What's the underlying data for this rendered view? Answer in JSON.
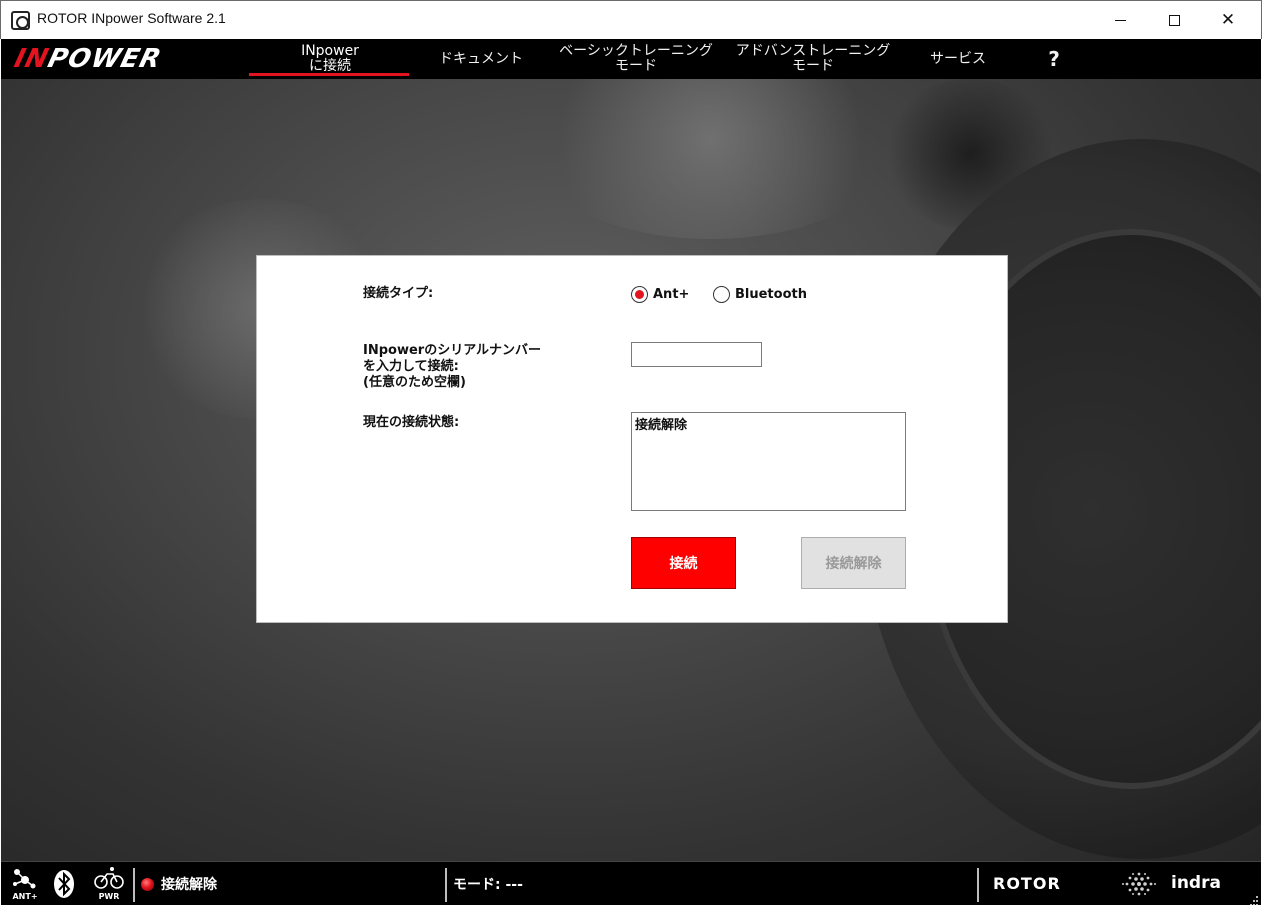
{
  "window": {
    "title": "ROTOR INpower Software 2.1"
  },
  "nav": {
    "logo_part1": "IN",
    "logo_part2": "POWER",
    "items": [
      {
        "label": "INpower\nに接続",
        "active": true
      },
      {
        "label": "ドキュメント"
      },
      {
        "label": "ベーシックトレーニング\nモード"
      },
      {
        "label": "アドバンストレーニング\nモード"
      },
      {
        "label": "サービス"
      },
      {
        "label": "?"
      }
    ]
  },
  "panel": {
    "connection_type_label": "接続タイプ:",
    "radio_ant": "Ant+",
    "radio_bluetooth": "Bluetooth",
    "selected": "Ant+",
    "serial_label": "INpowerのシリアルナンバー\nを入力して接続:\n(任意のため空欄)",
    "serial_value": "",
    "status_label": "現在の接続状態:",
    "status_value": "接続解除",
    "connect_button": "接続",
    "disconnect_button": "接続解除"
  },
  "statusbar": {
    "ant_label": "ANT+",
    "pwr_label": "PWR",
    "connection_status": "接続解除",
    "mode_text": "モード: ---",
    "brand_rotor": "ROTOR",
    "brand_indra": "indra"
  },
  "colors": {
    "accent_red": "#e3141f",
    "button_red": "#ff0000",
    "bar_black": "#000000"
  }
}
